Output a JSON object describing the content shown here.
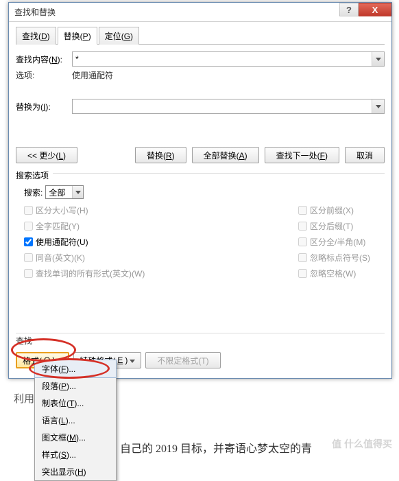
{
  "dialog": {
    "title": "查找和替换",
    "tabs": [
      {
        "label": "查找(",
        "key": "D",
        "suffix": ")"
      },
      {
        "label": "替换(",
        "key": "P",
        "suffix": ")"
      },
      {
        "label": "定位(",
        "key": "G",
        "suffix": ")"
      }
    ],
    "find_label": "查找内容(",
    "find_key": "N",
    "find_suffix": "):",
    "find_value": "*",
    "options_label": "选项:",
    "options_value": "使用通配符",
    "replace_label": "替换为(",
    "replace_key": "I",
    "replace_suffix": "):",
    "replace_value": ""
  },
  "buttons": {
    "less": "<< 更少(",
    "less_key": "L",
    "less_suffix": ")",
    "replace": "替换(",
    "replace_key": "R",
    "replace_suffix": ")",
    "replace_all": "全部替换(",
    "replace_all_key": "A",
    "replace_all_suffix": ")",
    "find_next": "查找下一处(",
    "find_next_key": "F",
    "find_next_suffix": ")",
    "cancel": "取消"
  },
  "search_options": {
    "legend": "搜索选项",
    "search_label": "搜索:",
    "search_value": "全部",
    "cb_case": "区分大小写(H)",
    "cb_whole": "全字匹配(Y)",
    "cb_wildcard": "使用通配符(U)",
    "cb_sounds": "同音(英文)(K)",
    "cb_forms": "查找单词的所有形式(英文)(W)",
    "cb_prefix": "区分前缀(X)",
    "cb_suffix": "区分后缀(T)",
    "cb_width": "区分全/半角(M)",
    "cb_punct": "忽略标点符号(S)",
    "cb_space": "忽略空格(W)"
  },
  "bottom": {
    "section": "查找",
    "format": "格式(",
    "format_key": "O",
    "format_suffix": ")",
    "special": "特殊格式(",
    "special_key": "E",
    "special_suffix": ")",
    "noformat": "不限定格式(T)"
  },
  "dropdown": {
    "items": [
      {
        "label": "字体(",
        "key": "F",
        "suffix": ")..."
      },
      {
        "label": "段落(",
        "key": "P",
        "suffix": ")..."
      },
      {
        "label": "制表位(",
        "key": "T",
        "suffix": ")..."
      },
      {
        "label": "语言(",
        "key": "L",
        "suffix": ")..."
      },
      {
        "label": "图文框(",
        "key": "M",
        "suffix": ")..."
      },
      {
        "label": "样式(",
        "key": "S",
        "suffix": ")..."
      },
      {
        "label": "突出显示(",
        "key": "H",
        "suffix": ")"
      }
    ]
  },
  "background": {
    "text1": "利用",
    "text2": "自己的 2019 目标，并寄语心梦太空的青",
    "watermark": "值 什么值得买"
  }
}
